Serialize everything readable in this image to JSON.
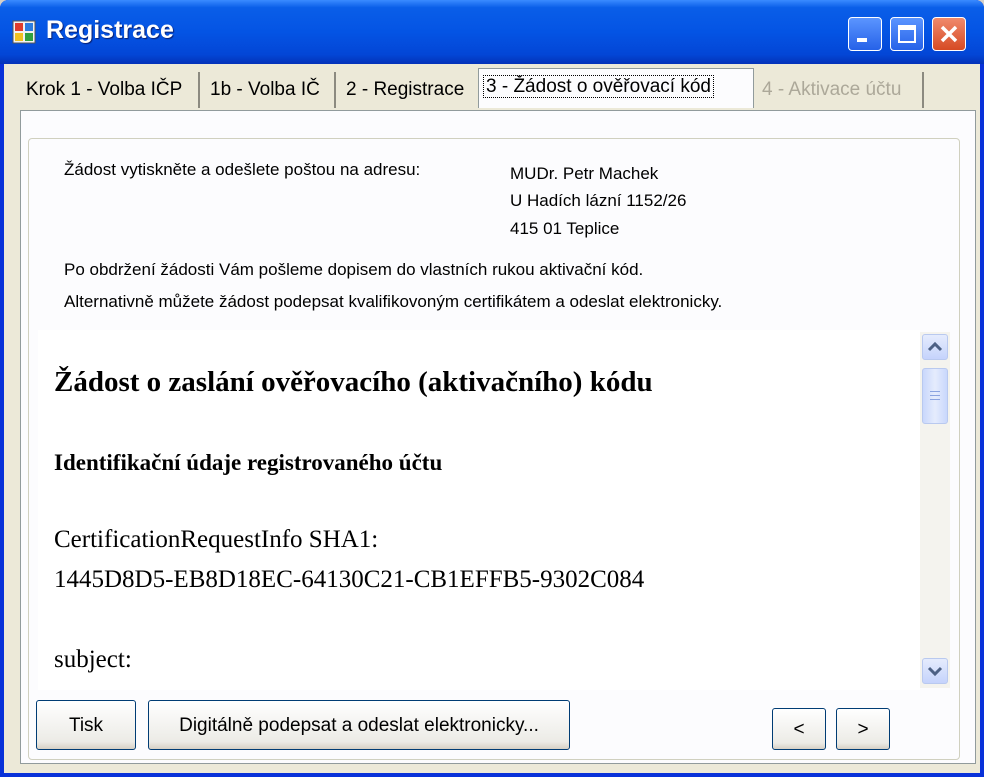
{
  "window": {
    "title": "Registrace"
  },
  "tabs": [
    {
      "label": "Krok 1 - Volba IČP",
      "state": "normal"
    },
    {
      "label": "1b - Volba IČ",
      "state": "normal"
    },
    {
      "label": "2 - Registrace",
      "state": "normal"
    },
    {
      "label": "3 - Žádost o ověřovací kód",
      "state": "active"
    },
    {
      "label": "4 - Aktivace účtu",
      "state": "disabled"
    }
  ],
  "info": {
    "mail_label": "Žádost vytiskněte a odešlete poštou na adresu:",
    "address": [
      "MUDr. Petr Machek",
      "U Hadích lázní 1152/26",
      "415 01 Teplice"
    ],
    "line1": "Po obdržení žádosti Vám pošleme dopisem do vlastních rukou aktivační kód.",
    "line2": "Alternativně můžete žádost podepsat kvalifikovoným certifikátem a odeslat elektronicky."
  },
  "document": {
    "heading": "Žádost o zaslání ověřovacího (aktivačního) kódu",
    "subheading": "Identifikační údaje registrovaného účtu",
    "sha_label": "CertificationRequestInfo SHA1:",
    "sha_value": "1445D8D5-EB8D18EC-64130C21-CB1EFFB5-9302C084",
    "subject_label": "subject:"
  },
  "buttons": {
    "print": "Tisk",
    "sign": "Digitálně podepsat a odeslat elektronicky...",
    "prev": "<",
    "next": ">"
  },
  "colors": {
    "titlebar": "#0454e4",
    "tab_disabled": "#aca899",
    "button_border": "#003c74"
  }
}
